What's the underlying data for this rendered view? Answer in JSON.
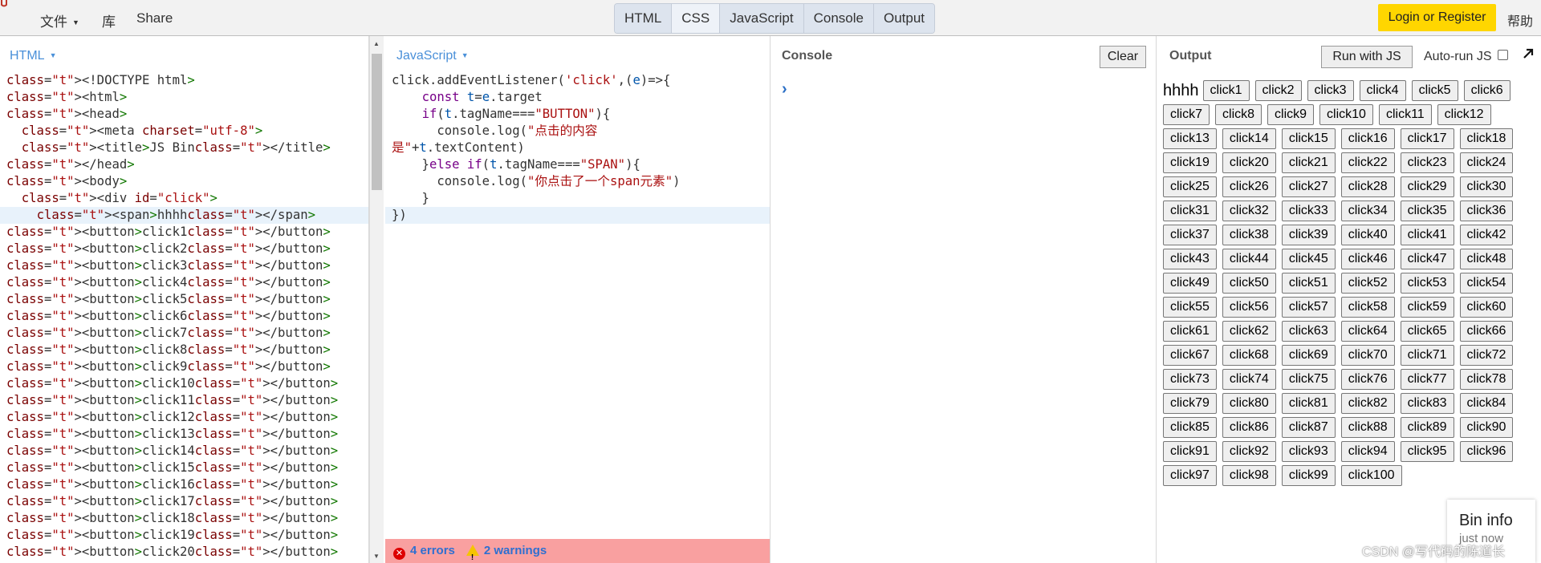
{
  "topbar": {
    "menu": [
      "文件",
      "库",
      "Share"
    ],
    "panel_toggles": [
      "HTML",
      "CSS",
      "JavaScript",
      "Console",
      "Output"
    ],
    "login_label": "Login or Register",
    "help_label": "帮助"
  },
  "html_panel": {
    "label": "HTML",
    "lines": [
      "<!DOCTYPE html>",
      "<html>",
      "<head>",
      "  <meta charset=\"utf-8\">",
      "  <title>JS Bin</title>",
      "</head>",
      "<body>",
      "  <div id=\"click\">",
      "    <span>hhhh</span>",
      "<button>click1</button>",
      "<button>click2</button>",
      "<button>click3</button>",
      "<button>click4</button>",
      "<button>click5</button>",
      "<button>click6</button>",
      "<button>click7</button>",
      "<button>click8</button>",
      "<button>click9</button>",
      "<button>click10</button>",
      "<button>click11</button>",
      "<button>click12</button>",
      "<button>click13</button>",
      "<button>click14</button>",
      "<button>click15</button>",
      "<button>click16</button>",
      "<button>click17</button>",
      "<button>click18</button>",
      "<button>click19</button>",
      "<button>click20</button>"
    ]
  },
  "js_panel": {
    "label": "JavaScript",
    "status": {
      "errors": "4 errors",
      "warnings": "2 warnings"
    }
  },
  "console_panel": {
    "title": "Console",
    "clear_label": "Clear",
    "prompt": "›"
  },
  "output_panel": {
    "title": "Output",
    "run_label": "Run with JS",
    "autorun_label": "Auto-run JS",
    "span_text": "hhhh",
    "buttons": [
      "click1",
      "click2",
      "click3",
      "click4",
      "click5",
      "click6",
      "click7",
      "click8",
      "click9",
      "click10",
      "click11",
      "click12",
      "click13",
      "click14",
      "click15",
      "click16",
      "click17",
      "click18",
      "click19",
      "click20",
      "click21",
      "click22",
      "click23",
      "click24",
      "click25",
      "click26",
      "click27",
      "click28",
      "click29",
      "click30",
      "click31",
      "click32",
      "click33",
      "click34",
      "click35",
      "click36",
      "click37",
      "click38",
      "click39",
      "click40",
      "click41",
      "click42",
      "click43",
      "click44",
      "click45",
      "click46",
      "click47",
      "click48",
      "click49",
      "click50",
      "click51",
      "click52",
      "click53",
      "click54",
      "click55",
      "click56",
      "click57",
      "click58",
      "click59",
      "click60",
      "click61",
      "click62",
      "click63",
      "click64",
      "click65",
      "click66",
      "click67",
      "click68",
      "click69",
      "click70",
      "click71",
      "click72",
      "click73",
      "click74",
      "click75",
      "click76",
      "click77",
      "click78",
      "click79",
      "click80",
      "click81",
      "click82",
      "click83",
      "click84",
      "click85",
      "click86",
      "click87",
      "click88",
      "click89",
      "click90",
      "click91",
      "click92",
      "click93",
      "click94",
      "click95",
      "click96",
      "click97",
      "click98",
      "click99",
      "click100"
    ],
    "bin_info_title": "Bin info",
    "bin_info_sub": "just now"
  },
  "watermark": "CSDN @写代码的陈道长",
  "colors": {
    "login_bg": "#ffd600",
    "panel_label": "#4a90d9",
    "status_bar_bg": "#f9a0a0"
  }
}
